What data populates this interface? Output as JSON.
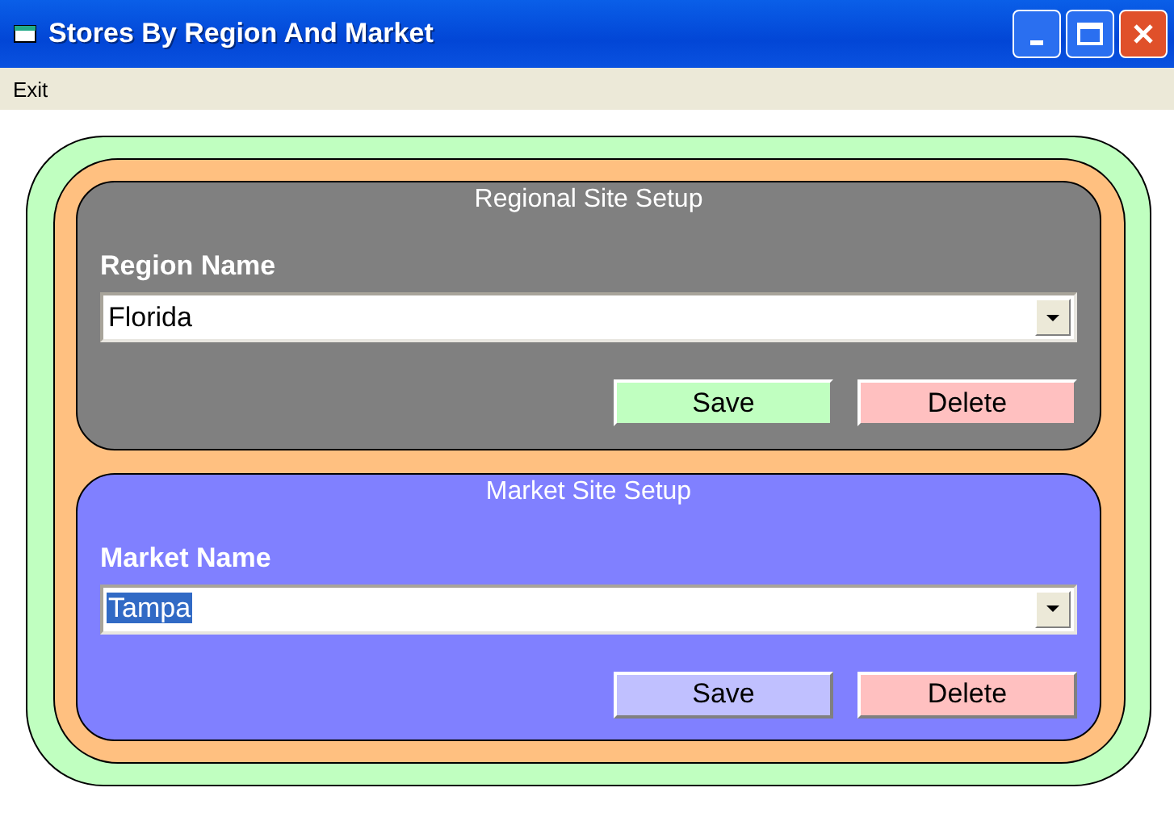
{
  "window": {
    "title": "Stores By Region And Market"
  },
  "menu": [
    "Exit"
  ],
  "panels": [
    {
      "kind": "region",
      "title": "Regional Site Setup",
      "label": "Region Name",
      "value": "Florida",
      "value_selected": false,
      "buttons": [
        {
          "kind": "save",
          "label": "Save"
        },
        {
          "kind": "delete",
          "label": "Delete"
        }
      ]
    },
    {
      "kind": "market",
      "title": "Market Site Setup",
      "label": "Market Name",
      "value": "Tampa",
      "value_selected": true,
      "buttons": [
        {
          "kind": "save",
          "label": "Save"
        },
        {
          "kind": "delete",
          "label": "Delete"
        }
      ]
    }
  ]
}
